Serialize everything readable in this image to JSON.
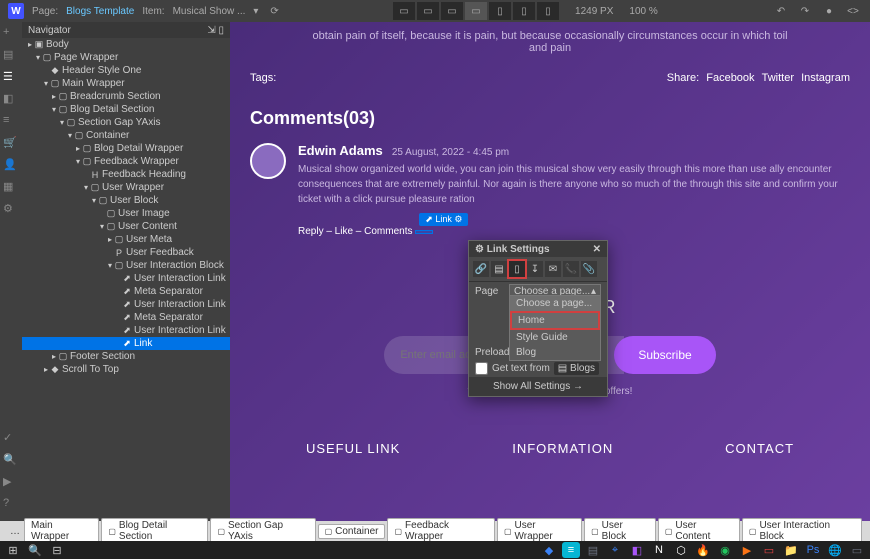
{
  "topbar": {
    "page_label": "Page:",
    "page_name": "Blogs Template",
    "item_label": "Item:",
    "item_name": "Musical Show ...",
    "dimensions": "1249 PX",
    "zoom": "100 %"
  },
  "navigator": {
    "title": "Navigator",
    "tree": [
      {
        "indent": 0,
        "arrow": "▸",
        "icon": "▣",
        "label": "Body"
      },
      {
        "indent": 1,
        "arrow": "▾",
        "icon": "▢",
        "label": "Page Wrapper"
      },
      {
        "indent": 2,
        "arrow": "",
        "icon": "◆",
        "label": "Header Style One"
      },
      {
        "indent": 2,
        "arrow": "▾",
        "icon": "▢",
        "label": "Main Wrapper"
      },
      {
        "indent": 3,
        "arrow": "▸",
        "icon": "▢",
        "label": "Breadcrumb Section"
      },
      {
        "indent": 3,
        "arrow": "▾",
        "icon": "▢",
        "label": "Blog Detail Section"
      },
      {
        "indent": 4,
        "arrow": "▾",
        "icon": "▢",
        "label": "Section Gap YAxis"
      },
      {
        "indent": 5,
        "arrow": "▾",
        "icon": "▢",
        "label": "Container"
      },
      {
        "indent": 6,
        "arrow": "▸",
        "icon": "▢",
        "label": "Blog Detail Wrapper"
      },
      {
        "indent": 6,
        "arrow": "▾",
        "icon": "▢",
        "label": "Feedback Wrapper"
      },
      {
        "indent": 7,
        "arrow": "",
        "icon": "H",
        "label": "Feedback Heading"
      },
      {
        "indent": 7,
        "arrow": "▾",
        "icon": "▢",
        "label": "User Wrapper"
      },
      {
        "indent": 8,
        "arrow": "▾",
        "icon": "▢",
        "label": "User Block"
      },
      {
        "indent": 9,
        "arrow": "",
        "icon": "▢",
        "label": "User Image"
      },
      {
        "indent": 9,
        "arrow": "▾",
        "icon": "▢",
        "label": "User Content"
      },
      {
        "indent": 10,
        "arrow": "▸",
        "icon": "▢",
        "label": "User Meta"
      },
      {
        "indent": 10,
        "arrow": "",
        "icon": "P",
        "label": "User Feedback"
      },
      {
        "indent": 10,
        "arrow": "▾",
        "icon": "▢",
        "label": "User Interaction Block"
      },
      {
        "indent": 11,
        "arrow": "",
        "icon": "⬈",
        "label": "User Interaction Link"
      },
      {
        "indent": 11,
        "arrow": "",
        "icon": "⬈",
        "label": "Meta Separator"
      },
      {
        "indent": 11,
        "arrow": "",
        "icon": "⬈",
        "label": "User Interaction Link"
      },
      {
        "indent": 11,
        "arrow": "",
        "icon": "⬈",
        "label": "Meta Separator"
      },
      {
        "indent": 11,
        "arrow": "",
        "icon": "⬈",
        "label": "User Interaction Link"
      },
      {
        "indent": 11,
        "arrow": "",
        "icon": "⬈",
        "label": "Link",
        "selected": true
      },
      {
        "indent": 3,
        "arrow": "▸",
        "icon": "▢",
        "label": "Footer Section"
      },
      {
        "indent": 2,
        "arrow": "▸",
        "icon": "◆",
        "label": "Scroll To Top"
      }
    ]
  },
  "canvas": {
    "body_text": "obtain pain of itself, because it is pain, but because occasionally circumstances occur in which toil and pain",
    "tags_label": "Tags:",
    "share_label": "Share:",
    "share_links": [
      "Facebook",
      "Twitter",
      "Instagram"
    ],
    "comments_title": "Comments(03)",
    "comment_name": "Edwin Adams",
    "comment_date": "25 August, 2022 - 4:45 pm",
    "comment_text": "Musical show organized world wide, you can join this musical show very easily through this more than use ally encounter consequences that are extremely painful. Nor again is there anyone who so much of the through this site and confirm your ticket with a click pursue pleasure ration",
    "actions": "Reply – Like – Comments",
    "link_badge": "Link",
    "link_sel": "",
    "newsletter_title": "NEWSLETTER",
    "newsletter_placeholder": "Enter email address",
    "subscribe": "Subscribe",
    "newsletter_note": "* For weekly latest update and offers!",
    "footer_cols": [
      "USEFUL LINK",
      "INFORMATION",
      "CONTACT"
    ]
  },
  "popup": {
    "title": "Link Settings",
    "page_label": "Page",
    "page_value": "Choose a page...",
    "preload_label": "Preload",
    "options": [
      "Choose a page...",
      "Home",
      "Style Guide",
      "Blog"
    ],
    "get_text": "Get text from",
    "get_text_val": "Blogs",
    "show_all": "Show All Settings  →"
  },
  "breadcrumbs": [
    "…",
    "Main Wrapper",
    "Blog Detail Section",
    "Section Gap YAxis",
    "Container",
    "Feedback Wrapper",
    "User Wrapper",
    "User Block",
    "User Content",
    "User Interaction Block"
  ]
}
